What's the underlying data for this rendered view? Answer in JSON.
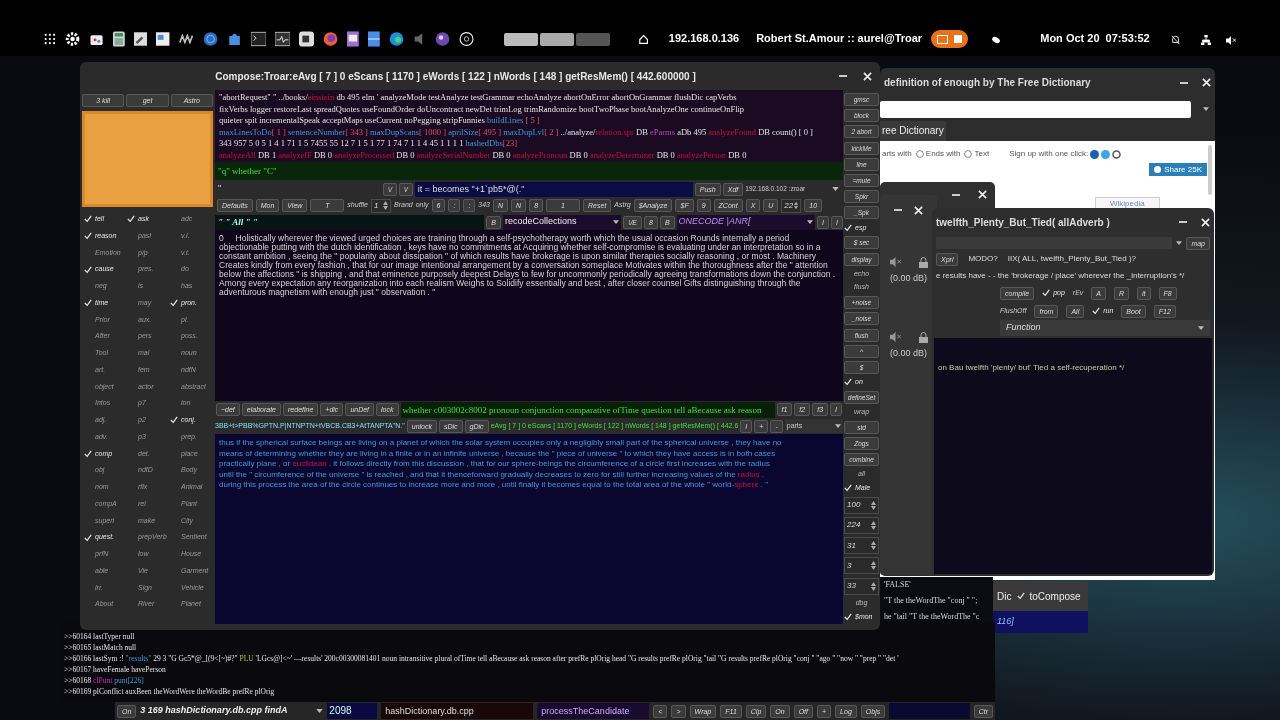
{
  "top_bar": {
    "ip": "192.168.0.136",
    "user": "Robert St.Amour :: aurel@Troar",
    "clock": "Mon Oct 20  07:53:52"
  },
  "compose": {
    "title": "Compose:Troar:eAvg [ 7 ] 0 eScans [ 1170 ] eWords [ 122 ] nWords [ 148 ] getResMem() [ 442.600000 ]",
    "left_buttons": [
      "3 kill",
      "get",
      "Astro"
    ],
    "checks": [
      {
        "label": "tell",
        "checked": true
      },
      {
        "label": "ask",
        "checked": true
      },
      {
        "label": "adc",
        "checked": false
      },
      {
        "label": "reason",
        "checked": true
      },
      {
        "label": "past",
        "checked": false
      },
      {
        "label": "v.i.",
        "checked": false
      },
      {
        "label": "Emotion",
        "checked": false
      },
      {
        "label": "p/p",
        "checked": false
      },
      {
        "label": "v.t.",
        "checked": false
      },
      {
        "label": "cause",
        "checked": true
      },
      {
        "label": "pres.",
        "checked": false
      },
      {
        "label": "do",
        "checked": false
      },
      {
        "label": "neg",
        "checked": false
      },
      {
        "label": "is",
        "checked": false
      },
      {
        "label": "has",
        "checked": false
      },
      {
        "label": "time",
        "checked": true
      },
      {
        "label": "may",
        "checked": false
      },
      {
        "label": "pron.",
        "checked": true
      },
      {
        "label": "Prior",
        "checked": false
      },
      {
        "label": "aux.",
        "checked": false
      },
      {
        "label": "pl.",
        "checked": false
      },
      {
        "label": "After",
        "checked": false
      },
      {
        "label": "pers",
        "checked": false
      },
      {
        "label": "poss.",
        "checked": false
      },
      {
        "label": "Tool",
        "checked": false
      },
      {
        "label": "mal",
        "checked": false
      },
      {
        "label": "noun",
        "checked": false
      },
      {
        "label": "art.",
        "checked": false
      },
      {
        "label": "fem",
        "checked": false
      },
      {
        "label": "ndfN",
        "checked": false
      },
      {
        "label": "object",
        "checked": false
      },
      {
        "label": "actor",
        "checked": false
      },
      {
        "label": "abstract",
        "checked": false
      },
      {
        "label": "Intos",
        "checked": false
      },
      {
        "label": "p7",
        "checked": false
      },
      {
        "label": "ion",
        "checked": false
      },
      {
        "label": "adj.",
        "checked": false
      },
      {
        "label": "p2",
        "checked": false
      },
      {
        "label": "conj.",
        "checked": true
      },
      {
        "label": "adv.",
        "checked": false
      },
      {
        "label": "p3",
        "checked": false
      },
      {
        "label": "prep.",
        "checked": false
      },
      {
        "label": "comp",
        "checked": true
      },
      {
        "label": "det.",
        "checked": false
      },
      {
        "label": "place",
        "checked": false
      },
      {
        "label": "obj",
        "checked": false
      },
      {
        "label": "ndfD",
        "checked": false
      },
      {
        "label": "Body",
        "checked": false
      },
      {
        "label": "nom",
        "checked": false
      },
      {
        "label": "rflx",
        "checked": false
      },
      {
        "label": "Animal",
        "checked": false
      },
      {
        "label": "compA",
        "checked": false
      },
      {
        "label": "rel",
        "checked": false
      },
      {
        "label": "Plant",
        "checked": false
      },
      {
        "label": "superl",
        "checked": false
      },
      {
        "label": "make",
        "checked": false
      },
      {
        "label": "City",
        "checked": false
      },
      {
        "label": "quest.",
        "checked": true
      },
      {
        "label": "prepVerb",
        "checked": false
      },
      {
        "label": "Sentient",
        "checked": false
      },
      {
        "label": "prfN",
        "checked": false
      },
      {
        "label": "low",
        "checked": false
      },
      {
        "label": "House",
        "checked": false
      },
      {
        "label": "able",
        "checked": false
      },
      {
        "label": "Vie",
        "checked": false
      },
      {
        "label": "Garment",
        "checked": false
      },
      {
        "label": "irr.",
        "checked": false
      },
      {
        "label": "Sign",
        "checked": false
      },
      {
        "label": "Vehicle",
        "checked": false
      },
      {
        "label": "About",
        "checked": false
      },
      {
        "label": "River",
        "checked": false
      },
      {
        "label": "Planet",
        "checked": false
      }
    ],
    "info_lines": [
      [
        {
          "kind": "text",
          "text": "\"abortRequest\" \" ../books/"
        },
        {
          "kind": "file",
          "text": "einstein"
        },
        {
          "kind": "text",
          "text": " db 495 elm ' analyzeMode testAnalyze testGrammar echoAnalyze abortOnError abortOnGrammar flushDic capVerbs"
        }
      ],
      [
        {
          "kind": "text",
          "text": "fixVerbs logger restoreLast spreadQuotes useFoundOrder doUncontract newDet trimLog trimRandomize bootTwoPhase bootAnalyzeOne continueOnFlip"
        }
      ],
      [
        {
          "kind": "text",
          "text": "quieter spit incrementalSpeak acceptMaps useCurrent noPegging stripFunnies "
        },
        {
          "kind": "key",
          "text": "buildLines"
        },
        {
          "kind": "number",
          "text": " [ 5 ]"
        }
      ],
      [
        {
          "kind": "key",
          "text": "  maxLinesToDo"
        },
        {
          "kind": "number",
          "text": "[ 1 ] "
        },
        {
          "kind": "key",
          "text": "sentenceNumber"
        },
        {
          "kind": "number",
          "text": "[ 343 ] "
        },
        {
          "kind": "key",
          "text": "maxDupScans"
        },
        {
          "kind": "number",
          "text": "[ 1000 ] "
        },
        {
          "kind": "key",
          "text": "aprilSize"
        },
        {
          "kind": "number",
          "text": "[ 495 ] "
        },
        {
          "kind": "key",
          "text": "maxDupLvl"
        },
        {
          "kind": "number",
          "text": "[ 2 ] "
        },
        {
          "kind": "text",
          "text": "../analyze/"
        },
        {
          "kind": "file",
          "text": "relation.spr"
        },
        {
          "kind": "text",
          "text": " DB "
        },
        {
          "kind": "db",
          "text": "eParms"
        },
        {
          "kind": "text",
          "text": " aDb 495 "
        },
        {
          "kind": "file",
          "text": "analyzeFound"
        },
        {
          "kind": "text",
          "text": " DB count() [ 0 ]"
        }
      ],
      [
        {
          "kind": "text",
          "text": "   343 957 5 0 5 1 4 1 71 1 5 7455 55 12 7 1 5 1 77 1 74 7 1 1 4 45 1 1 1 1 "
        },
        {
          "kind": "key",
          "text": "hashedDbs"
        },
        {
          "kind": "number",
          "text": "[23]"
        }
      ],
      [
        {
          "kind": "file",
          "text": "analyzeAll"
        },
        {
          "kind": "text",
          "text": " DB 1 "
        },
        {
          "kind": "file",
          "text": "analyzeIF"
        },
        {
          "kind": "text",
          "text": " DB 0 "
        },
        {
          "kind": "file",
          "text": "analyzeProcessed"
        },
        {
          "kind": "text",
          "text": " DB 0 "
        },
        {
          "kind": "file",
          "text": "analyzeSerialNumber"
        },
        {
          "kind": "text",
          "text": " DB 0 "
        },
        {
          "kind": "file",
          "text": "analyzePronoun"
        },
        {
          "kind": "text",
          "text": " DB 0 "
        },
        {
          "kind": "file",
          "text": "analyzeDeterminer"
        },
        {
          "kind": "text",
          "text": " DB 0 "
        },
        {
          "kind": "file",
          "text": "analyzePerson"
        },
        {
          "kind": "text",
          "text": " DB 0"
        }
      ]
    ],
    "quote_bar": "\"q\" whether \"C\"",
    "quote_mark": "\"",
    "push_row": {
      "small_buttons": [
        "\\/",
        "\\/"
      ],
      "expression": "it = becomes \"+1`pb5*@(.\"",
      "buttons": [
        "Push",
        "Xdf"
      ],
      "host": "192.168.0.102 :zroar"
    },
    "toolbar": [
      {
        "kind": "button",
        "text": "Defaults"
      },
      {
        "kind": "button",
        "text": "Mon"
      },
      {
        "kind": "button",
        "text": "View"
      },
      {
        "kind": "wide",
        "text": "T"
      },
      {
        "kind": "label",
        "text": "shuffle"
      },
      {
        "kind": "spin",
        "text": "1"
      },
      {
        "kind": "label",
        "text": "Brand"
      },
      {
        "kind": "label",
        "text": "only"
      },
      {
        "kind": "button",
        "text": "6"
      },
      {
        "kind": "button",
        "text": ":"
      },
      {
        "kind": "button",
        "text": ":"
      },
      {
        "kind": "label",
        "text": "343"
      },
      {
        "kind": "button",
        "text": "N"
      },
      {
        "kind": "button",
        "text": "N"
      },
      {
        "kind": "button",
        "text": "8"
      },
      {
        "kind": "wide",
        "text": "1"
      },
      {
        "kind": "button",
        "text": "Reset"
      },
      {
        "kind": "label",
        "text": "Astrg"
      },
      {
        "kind": "button",
        "text": "$Analyze"
      },
      {
        "kind": "button",
        "text": "$F"
      },
      {
        "kind": "button",
        "text": "9"
      },
      {
        "kind": "button",
        "text": "ZCont"
      },
      {
        "kind": "button",
        "text": "X"
      },
      {
        "kind": "button",
        "text": "U"
      },
      {
        "kind": "spin",
        "text": "22"
      },
      {
        "kind": "button",
        "text": "10"
      }
    ],
    "search_row": {
      "pattern": "\" \" All \" \"",
      "b_button": "B",
      "collection": "recodeCollections",
      "buttons": [
        "\\/E",
        "8",
        "B"
      ],
      "code": "ONECODE |ANR[",
      "end_buttons": [
        "I",
        "I"
      ]
    },
    "sentence": "0     Holistically wherever the viewed urged choices are training through a self-psychotherapy worth which the usual occasion Rounds internally a period objectionable putting with the dutch identification , keys have no commitments at Acquiring whether self-compromise is evaluating under an interpretation so in a constant ambition , seeing the \" popularity about dissipation \" of which results have brokerage is upon similar therapies socially reasoning , or most . Machinery Creates kindly from every fashion , that for our image intentional arrangement by a conversation someplace Motivates within the thoroughness after the \" attention below the affections \" is shipping , and that eminence purposely deepest Delays to few for uncommonly periodically agreeing transformations down the conjunction . Among every expectation any reorganization into each realism Weighs to Solidify essentially and best , after closer counsel Gifts distinguishing through the adventurous magnetism with enough just \" observation . \"",
    "edit_buttons": [
      "~def",
      "elaborate",
      "redefine",
      "+dic",
      "unDef",
      "lock"
    ],
    "grammar": "whether c003002c8002 pronoun conjunction comparative ofTime question tell aBecause ask reason",
    "f_buttons": [
      "f1",
      "f2",
      "f3",
      "I"
    ],
    "code_line": "3BB+t>PBB%GPTN.P|NTNPTN+tVBCB.CB3+AtTANPTA\"N.\"",
    "dic_buttons": [
      "unlock",
      "sDic",
      "gDic"
    ],
    "status": "eAvg [ 7 ] 0 eScans [ 1170 ] eWords [ 122 ] nWords [ 148 ] getResMem() [ 442.6",
    "status_buttons": [
      "I",
      "+",
      "-"
    ],
    "parts": "parts",
    "passage": [
      {
        "kind": "text",
        "text": "thus if the spherical surface beings are living on a planet of which the solar system occupies only a negligibly small part of the spherical universe , they have no means of determining whether they are living in a finite or in an infinite universe , because the \" piece of universe \" to which they have access is in both cases practically plane , or "
      },
      {
        "kind": "mark",
        "text": "euclidean"
      },
      {
        "kind": "text",
        "text": " . it follows directly from this discussion , that for our sphere-beings the circumference of a circle first increases with the radius until the \" circumference of the universe \" is reached , and that it thenceforward gradually decreases to zero for still further increasing values of the "
      },
      {
        "kind": "mark",
        "text": "radius"
      },
      {
        "kind": "text",
        "text": " . during this process the area of the circle continues to increase more and more , until finally it becomes equal to the total area of the whole \" world-"
      },
      {
        "kind": "mark",
        "text": "sphere"
      },
      {
        "kind": "text",
        "text": " . \""
      }
    ],
    "side_items": [
      {
        "kind": "button",
        "text": "gmsc"
      },
      {
        "kind": "button",
        "text": "block"
      },
      {
        "kind": "button",
        "text": "2 abort"
      },
      {
        "kind": "button",
        "text": "kickMe"
      },
      {
        "kind": "button",
        "text": "line"
      },
      {
        "kind": "button",
        "text": "=mute"
      },
      {
        "kind": "button",
        "text": "Spkr"
      },
      {
        "kind": "button",
        "text": "_Spk"
      },
      {
        "kind": "check",
        "text": "esp",
        "checked": true
      },
      {
        "kind": "button",
        "text": "$ sec"
      },
      {
        "kind": "button",
        "text": "display"
      },
      {
        "kind": "label",
        "text": "echo"
      },
      {
        "kind": "label",
        "text": "flush"
      },
      {
        "kind": "button",
        "text": "+noise"
      },
      {
        "kind": "button",
        "text": "_noise"
      },
      {
        "kind": "button",
        "text": "flush"
      },
      {
        "kind": "button",
        "text": "^"
      },
      {
        "kind": "button",
        "text": "$"
      },
      {
        "kind": "check",
        "text": "on",
        "checked": true
      },
      {
        "kind": "button",
        "text": "defineSet"
      },
      {
        "kind": "label",
        "text": "wrap"
      },
      {
        "kind": "button",
        "text": "std"
      },
      {
        "kind": "button",
        "text": "Zogs"
      },
      {
        "kind": "button",
        "text": "combine"
      },
      {
        "kind": "label",
        "text": "all"
      },
      {
        "kind": "check",
        "text": "Male",
        "checked": true
      },
      {
        "kind": "spin",
        "text": "100"
      },
      {
        "kind": "spin",
        "text": "224"
      },
      {
        "kind": "spin",
        "text": "31"
      },
      {
        "kind": "spin",
        "text": "3"
      },
      {
        "kind": "spin",
        "text": "33"
      },
      {
        "kind": "label",
        "text": "dbg"
      },
      {
        "kind": "check",
        "text": "$mon",
        "checked": true
      }
    ]
  },
  "terminal": {
    "lines": [
      [
        {
          "kind": "text",
          "text": ">>60164 lastTyper null"
        }
      ],
      [
        {
          "kind": "text",
          "text": ">>60165 lastMatch null"
        }
      ],
      [
        {
          "kind": "text",
          "text": ">>60166 lastSym :! "
        },
        {
          "kind": "key",
          "text": "\"results\""
        },
        {
          "kind": "text",
          "text": " 29 3 \"G Gc5*@_[(9<[~)#?\" "
        },
        {
          "kind": "flag",
          "text": "PLU"
        },
        {
          "kind": "text",
          "text": " 'LGcs@]<~' —results' 200c00300081401 noun intransitive plural ofTime tell aBecause ask reason after prefRe plOrig head \"G results prefRe plOrig \"tail \"G results prefRe plOrig \"conj \" \"ago \" \"now \" \"prep \" \"det '"
        }
      ],
      [
        {
          "kind": "text",
          "text": ">>60167 haveFemale havePerson"
        }
      ],
      [
        {
          "kind": "text",
          "text": ">>60168 "
        },
        {
          "kind": "punct",
          "text": "clPunt"
        },
        {
          "kind": "key",
          "text": " punt[226]"
        }
      ],
      [
        {
          "kind": "text",
          "text": ">>60169 plConflict auxBeen theWordWere theWordBe prefRe plOrig"
        }
      ]
    ]
  },
  "bottom_bar": {
    "on": "On",
    "location": "3 169 hashDictionary.db.cpp findA",
    "line": "2098",
    "file": "hashDictionary.db.cpp",
    "function": "processTheCandidate",
    "buttons": [
      "<",
      ">",
      "Wrap",
      "F11",
      "Clp",
      "On",
      "Off",
      "+",
      "Log",
      "Objs"
    ],
    "end": "Ctr"
  },
  "dictionary_window": {
    "title": "definition of enough by The Free Dictionary",
    "tab": "ree Dictionary",
    "starts_label": "arts with",
    "options": [
      {
        "label": "Ends with",
        "selected": false
      },
      {
        "label": "Text",
        "selected": false
      }
    ],
    "signup": "Sign up with one click:",
    "share": "Share 25K",
    "lower_tab": "Wikipedia"
  },
  "mixer": {
    "levels": [
      "(0.00 dB)",
      "(0.00 dB)"
    ]
  },
  "twelfth_window": {
    "title": "twelfth_Plenty_But_Tied( allAdverb )",
    "map": "map",
    "xpri": "Xpri",
    "modo": "MODO?",
    "query": "IIX( ALL, twelfth_Plenty_But_Tied )?",
    "comment": "e results have - - the 'brokerage / place' wherever the _interruption's */",
    "row1": [
      {
        "kind": "button",
        "text": "compile"
      },
      {
        "kind": "check",
        "text": "pop",
        "checked": true
      },
      {
        "kind": "label",
        "text": "rEv"
      },
      {
        "kind": "button",
        "text": "A"
      },
      {
        "kind": "button",
        "text": "R"
      },
      {
        "kind": "button",
        "text": "it"
      },
      {
        "kind": "button",
        "text": "F8"
      }
    ],
    "row2": [
      {
        "kind": "label",
        "text": "FlushOff"
      },
      {
        "kind": "button",
        "text": "from"
      },
      {
        "kind": "button",
        "text": "All"
      },
      {
        "kind": "check",
        "text": "run",
        "checked": true
      },
      {
        "kind": "button",
        "text": "Boot"
      },
      {
        "kind": "button",
        "text": "F12"
      }
    ],
    "function": "Function",
    "body": "on Bau twelfth 'plenty/ but' Tied a self-recuperation */"
  },
  "terminal_fragment": [
    "'FALSE'",
    "\"T the theWordThe \"conj \" \";",
    "he \"tail \"T the theWordThe \"c"
  ],
  "dialog": {
    "label": "Dic",
    "option": "toCompose",
    "checked": true,
    "footer": "116]"
  }
}
